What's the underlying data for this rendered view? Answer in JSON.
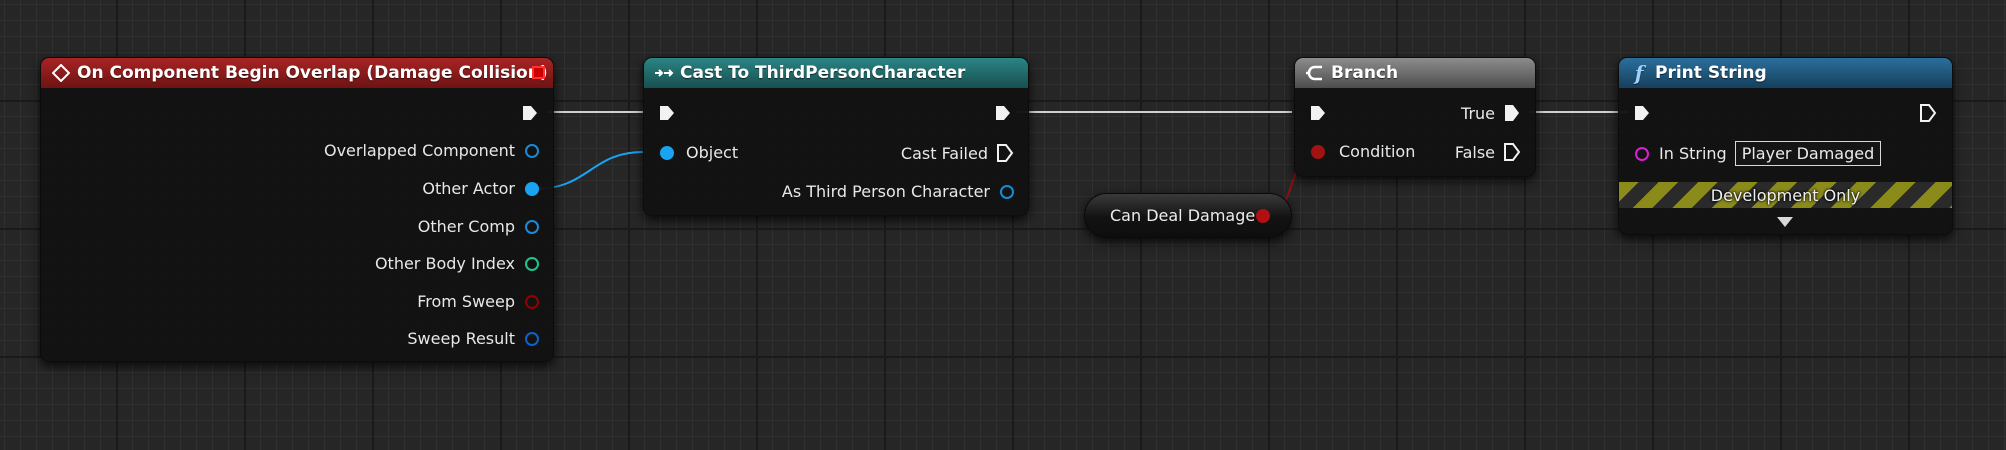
{
  "nodes": {
    "event": {
      "title": "On Component Begin Overlap (Damage Collision)",
      "pins": [
        "Overlapped Component",
        "Other Actor",
        "Other Comp",
        "Other Body Index",
        "From Sweep",
        "Sweep Result"
      ],
      "colors": {
        "header": "#8a1b1b",
        "object": "#1aa3f0",
        "int": "#1fc48f",
        "bool": "#940000",
        "struct": "#0d62c9"
      },
      "icon": "event-diamond-icon"
    },
    "cast": {
      "title": "Cast To ThirdPersonCharacter",
      "in_object": "Object",
      "cast_failed": "Cast Failed",
      "as_output": "As Third Person Character",
      "colors": {
        "header": "#1f6b6b"
      },
      "icon": "cast-arrows-icon"
    },
    "variable": {
      "label": "Can Deal Damage",
      "colors": {
        "pin": "#b01010"
      }
    },
    "branch": {
      "title": "Branch",
      "condition": "Condition",
      "true_label": "True",
      "false_label": "False",
      "colors": {
        "header": "#6e6e6e"
      },
      "icon": "branch-icon"
    },
    "print": {
      "title": "Print String",
      "in_string_label": "In String",
      "in_string_value": "Player Damaged",
      "dev_label": "Development Only",
      "colors": {
        "header": "#1e5a82",
        "string_pin": "#d61fd6"
      },
      "icon": "function-icon"
    }
  }
}
